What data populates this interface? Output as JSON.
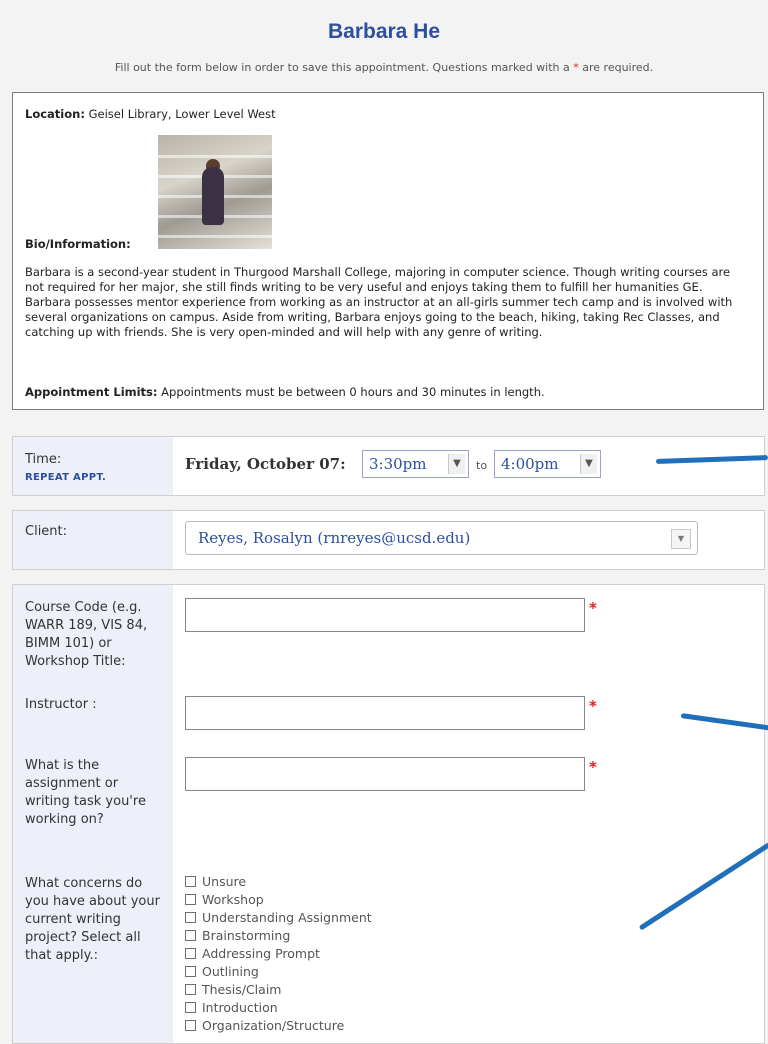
{
  "header": {
    "title": "Barbara He",
    "intro_before": "Fill out the form below in order to save this appointment. Questions marked with a",
    "intro_star": "*",
    "intro_after": "are required."
  },
  "info": {
    "location_label": "Location:",
    "location_value": "Geisel Library, Lower Level West",
    "bio_label": "Bio/Information:",
    "bio_text": "Barbara is a second-year student in Thurgood Marshall College, majoring in computer science. Though writing courses are not required for her major, she still finds writing to be very useful and enjoys taking them to fulfill her humanities GE. Barbara possesses mentor experience from working as an instructor at an all-girls summer tech camp and is involved with several organizations on campus. Aside from writing, Barbara enjoys going to the beach, hiking, taking Rec Classes, and catching up with friends. She is very open-minded and will help with any genre of writing.",
    "limits_label": "Appointment Limits:",
    "limits_value": "Appointments must be between 0 hours and 30 minutes in length."
  },
  "time": {
    "label": "Time:",
    "repeat_link": "REPEAT APPT.",
    "date": "Friday, October 07:",
    "start": "3:30pm",
    "to": "to",
    "end": "4:00pm"
  },
  "client": {
    "label": "Client:",
    "value": "Reyes, Rosalyn (rnreyes@ucsd.edu)"
  },
  "form": {
    "course_label": "Course Code (e.g. WARR 189, VIS 84, BIMM 101) or Workshop Title:",
    "course_value": "",
    "instructor_label": "Instructor :",
    "instructor_value": "",
    "assignment_label": "What is the assignment or writing task you're working on?",
    "assignment_value": "",
    "concerns_label": "What concerns do you have about your current writing project? Select all that apply.:",
    "required_star": "*",
    "concerns": [
      "Unsure",
      "Workshop",
      "Understanding Assignment",
      "Brainstorming",
      "Addressing Prompt",
      "Outlining",
      "Thesis/Claim",
      "Introduction",
      "Organization/Structure"
    ]
  },
  "colors": {
    "title": "#2d4fa0",
    "label_bg": "#eef0f9",
    "required": "#e0201d",
    "annotation": "#1f6fba"
  },
  "icons": {
    "select_arrow": "chevron-down-icon"
  }
}
